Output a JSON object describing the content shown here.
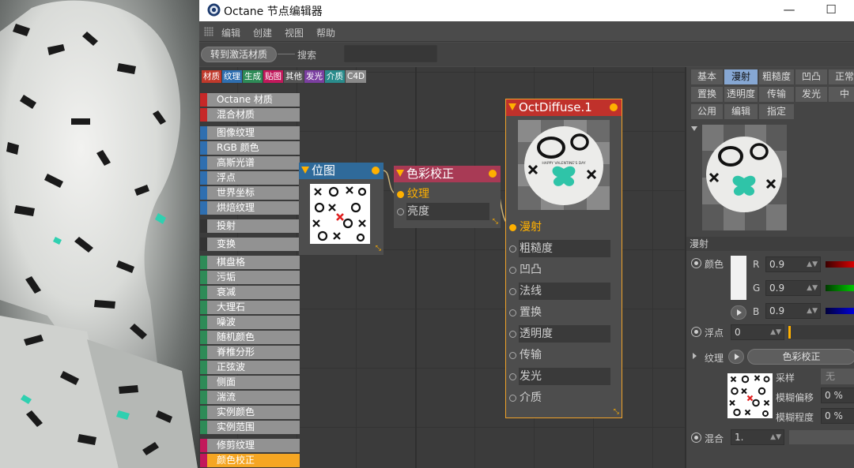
{
  "window": {
    "title": "Octane 节点编辑器",
    "minimize_glyph": "—",
    "maximize_glyph": "☐"
  },
  "menu": [
    "编辑",
    "创建",
    "视图",
    "帮助"
  ],
  "toolbar": {
    "goto_button": "转到激活材质",
    "search_label": "搜索",
    "search_value": ""
  },
  "categories": [
    {
      "label": "材质",
      "color": "#c0392b"
    },
    {
      "label": "纹理",
      "color": "#2f6fb0"
    },
    {
      "label": "生成",
      "color": "#2e8b57"
    },
    {
      "label": "贴图",
      "color": "#c2185b"
    },
    {
      "label": "其他",
      "color": "#555555"
    },
    {
      "label": "发光",
      "color": "#7b3fa0"
    },
    {
      "label": "介质",
      "color": "#2a8c8c"
    },
    {
      "label": "C4D",
      "color": "#8a8a8a"
    }
  ],
  "palette": [
    {
      "label": "Octane 材质",
      "color": "#c62828"
    },
    {
      "label": "混合材质",
      "color": "#c62828"
    },
    {
      "gap": true
    },
    {
      "label": "图像纹理",
      "color": "#2f6fb0"
    },
    {
      "label": "RGB 颜色",
      "color": "#2f6fb0"
    },
    {
      "label": "高斯光谱",
      "color": "#2f6fb0"
    },
    {
      "label": "浮点",
      "color": "#2f6fb0"
    },
    {
      "label": "世界坐标",
      "color": "#2f6fb0"
    },
    {
      "label": "烘焙纹理",
      "color": "#2f6fb0"
    },
    {
      "gap": true
    },
    {
      "label": "投射",
      "color": "#333333"
    },
    {
      "gap": true
    },
    {
      "label": "变换",
      "color": "#333333"
    },
    {
      "gap": true
    },
    {
      "label": "棋盘格",
      "color": "#2e8b57"
    },
    {
      "label": "污垢",
      "color": "#2e8b57"
    },
    {
      "label": "衰减",
      "color": "#2e8b57"
    },
    {
      "label": "大理石",
      "color": "#2e8b57"
    },
    {
      "label": "噪波",
      "color": "#2e8b57"
    },
    {
      "label": "随机颜色",
      "color": "#2e8b57"
    },
    {
      "label": "脊椎分形",
      "color": "#2e8b57"
    },
    {
      "label": "正弦波",
      "color": "#2e8b57"
    },
    {
      "label": "侧面",
      "color": "#2e8b57"
    },
    {
      "label": "湍流",
      "color": "#2e8b57"
    },
    {
      "label": "实例颜色",
      "color": "#2e8b57"
    },
    {
      "label": "实例范围",
      "color": "#2e8b57"
    },
    {
      "gap": true
    },
    {
      "label": "修剪纹理",
      "color": "#c2185b"
    },
    {
      "label": "颜色校正",
      "color": "#c2185b",
      "selected": true
    }
  ],
  "nodes": {
    "bitmap": {
      "title": "位图",
      "color": "#2f6a9a"
    },
    "colorcorrect": {
      "title": "色彩校正",
      "color": "#a83a55",
      "ports": [
        "纹理",
        "亮度"
      ]
    },
    "diffuse": {
      "title": "OctDiffuse.1",
      "color": "#c0312b",
      "ports": [
        "漫射",
        "粗糙度",
        "凹凸",
        "法线",
        "置换",
        "透明度",
        "传输",
        "发光",
        "介质"
      ]
    }
  },
  "panel": {
    "tabs_row1": [
      "基本",
      "漫射",
      "粗糙度",
      "凹凸",
      "正常"
    ],
    "tabs_row2": [
      "置换",
      "透明度",
      "传输",
      "发光",
      "中"
    ],
    "tabs_row3": [
      "公用",
      "编辑",
      "指定"
    ],
    "active_tab": "漫射",
    "section": "漫射",
    "color_label": "颜色",
    "r_label": "R",
    "r_value": "0.9",
    "g_label": "G",
    "g_value": "0.9",
    "b_label": "B",
    "b_value": "0.9",
    "float_label": "浮点",
    "float_value": "0",
    "texture_label": "纹理",
    "texture_value": "色彩校正",
    "sample_label": "采样",
    "sample_value": "无",
    "blur_offset_label": "模糊偏移",
    "blur_offset_value": "0 %",
    "blur_amount_label": "模糊程度",
    "blur_amount_value": "0 %",
    "mix_label": "混合",
    "mix_value": "1."
  },
  "preview_text": "HAPPY VALENTINE'S DAY",
  "colors": {
    "accent": "#ffb000",
    "active_tab": "#86a7d3",
    "selected_item": "#f5a623"
  }
}
